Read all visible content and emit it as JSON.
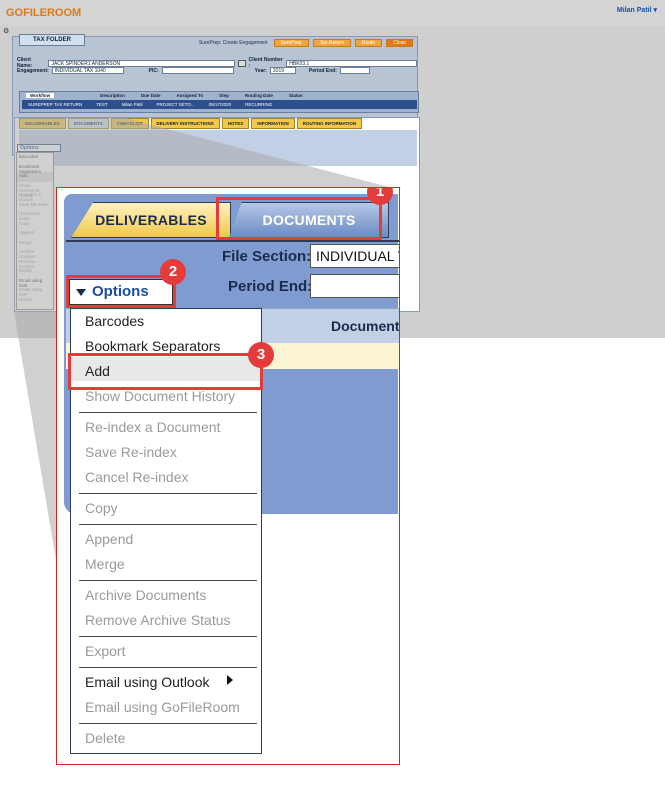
{
  "app": {
    "logo": "GOFILEROOM",
    "user": "Milan Patil ▾"
  },
  "folder": {
    "tab": "TAX FOLDER",
    "action_label": "SurePrep: Create Engagement",
    "buttons": [
      "SurePrep",
      "Tax Return",
      "Route",
      "Close"
    ],
    "client_name_label": "Client Name:",
    "client_name": "JACK SPINDER1 ANDERSON",
    "client_number_label": "Client Number :",
    "client_number": "HBK03.1",
    "engagement_label": "Engagement:",
    "engagement": "INDIVIDUAL TAX 1040",
    "pic_label": "PIC:",
    "year_label": "Year:",
    "year": "2019",
    "period_end_label": "Period End:",
    "workflow": {
      "label": "Workflow",
      "headers": [
        "Description",
        "Due Date",
        "Assigned To",
        "Step",
        "Routing Date",
        "Status"
      ],
      "row": [
        "SUREPREP TAX RETURN",
        "TEST",
        "",
        "Milan Patil",
        "PROJECT SETO...",
        "09/17/2020",
        "RECURRING"
      ]
    }
  },
  "mini": {
    "tabs": [
      "DELIVERABLES",
      "DOCUMENTS",
      "CHECKLIST",
      "DELIVERY INSTRUCTIONS",
      "NOTES",
      "INFORMATION",
      "ROUTING INFORMATION"
    ],
    "options": "Options",
    "menu": [
      "Barcodes",
      "Bookmark Separators",
      "Add",
      "Show Document History",
      "Re-index a Docum",
      "Save Re-index",
      "Cancel Re-index",
      "Copy",
      "Append",
      "Merge",
      "Archive Docume",
      "Remove Archive",
      "Export",
      "Email using Outl",
      "Email using GoF",
      "Delete"
    ]
  },
  "zoom": {
    "tab_deliverables": "DELIVERABLES",
    "tab_documents": "DOCUMENTS",
    "file_section_label": "File Section:",
    "file_section_value": "INDIVIDUAL T",
    "period_end_label": "Period End:",
    "grid_column": "Document",
    "options_label": "Options",
    "menu": [
      {
        "label": "Barcodes",
        "enabled": true
      },
      {
        "label": "Bookmark Separators",
        "enabled": true
      },
      {
        "label": "Add",
        "enabled": true
      },
      {
        "label": "Show Document History",
        "enabled": false
      },
      {
        "label": "Re-index a Document",
        "enabled": false
      },
      {
        "label": "Save Re-index",
        "enabled": false
      },
      {
        "label": "Cancel Re-index",
        "enabled": false
      },
      {
        "label": "Copy",
        "enabled": false
      },
      {
        "label": "Append",
        "enabled": false
      },
      {
        "label": "Merge",
        "enabled": false
      },
      {
        "label": "Archive Documents",
        "enabled": false
      },
      {
        "label": "Remove Archive Status",
        "enabled": false
      },
      {
        "label": "Export",
        "enabled": false
      },
      {
        "label": "Email using Outlook",
        "enabled": true
      },
      {
        "label": "Email using GoFileRoom",
        "enabled": false
      },
      {
        "label": "Delete",
        "enabled": false
      }
    ]
  },
  "badges": [
    "1",
    "2",
    "3"
  ],
  "colors": {
    "highlight": "#e53b3b",
    "link": "#1a4fa0",
    "accent": "#e07a10"
  }
}
